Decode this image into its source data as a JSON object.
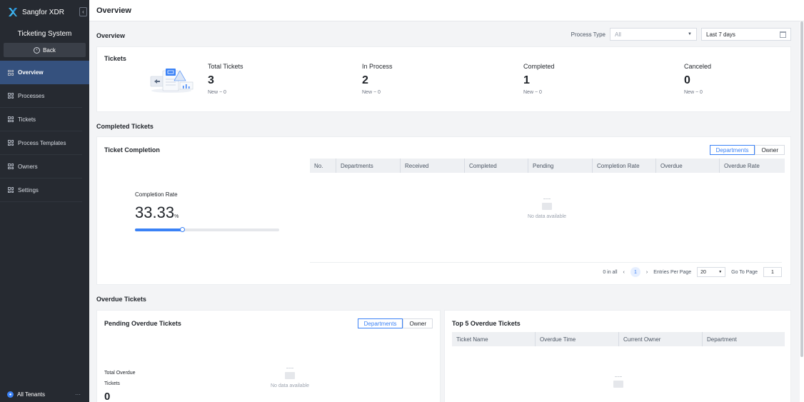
{
  "app": {
    "brand": "Sangfor XDR",
    "system_title": "Ticketing System",
    "back_label": "Back"
  },
  "sidebar": {
    "items": [
      {
        "label": "Overview",
        "active": true
      },
      {
        "label": "Processes",
        "active": false
      },
      {
        "label": "Tickets",
        "active": false
      },
      {
        "label": "Process Templates",
        "active": false
      },
      {
        "label": "Owners",
        "active": false
      },
      {
        "label": "Settings",
        "active": false
      }
    ],
    "tenant": "All Tenants",
    "tenant_more": "···"
  },
  "header": {
    "title": "Overview"
  },
  "overview": {
    "section_title": "Overview",
    "process_type_label": "Process Type",
    "process_type_value": "All",
    "date_range": "Last 7 days"
  },
  "tickets": {
    "title": "Tickets",
    "stats": [
      {
        "label": "Total Tickets",
        "value": "3",
        "new": "New − 0"
      },
      {
        "label": "In Process",
        "value": "2",
        "new": "New − 0"
      },
      {
        "label": "Completed",
        "value": "1",
        "new": "New − 0"
      },
      {
        "label": "Canceled",
        "value": "0",
        "new": "New − 0"
      }
    ]
  },
  "completed": {
    "section_title": "Completed Tickets",
    "card_title": "Ticket Completion",
    "toggle": {
      "departments": "Departments",
      "owner": "Owner"
    },
    "rate_label": "Completion Rate",
    "rate_value": "33.33",
    "rate_unit": "%",
    "rate_fraction": 0.3333,
    "columns": [
      "No.",
      "Departments",
      "Received",
      "Completed",
      "Pending",
      "Completion Rate",
      "Overdue",
      "Overdue Rate"
    ],
    "empty_text": "No data available",
    "pager": {
      "total": "0 in all",
      "prev": "‹",
      "current": "1",
      "next": "›",
      "per_page_label": "Entries Per Page",
      "per_page_value": "20",
      "goto_label": "Go To Page",
      "goto_value": "1"
    }
  },
  "overdue": {
    "section_title": "Overdue Tickets",
    "pending_title": "Pending Overdue Tickets",
    "toggle": {
      "departments": "Departments",
      "owner": "Owner"
    },
    "total_label_1": "Total Overdue",
    "total_label_2": "Tickets",
    "total_value": "0",
    "empty_text": "No data available",
    "top5_title": "Top 5 Overdue Tickets",
    "top5_columns": [
      "Ticket Name",
      "Overdue Time",
      "Current Owner",
      "Department"
    ]
  },
  "colors": {
    "accent": "#3b82f6",
    "sidebar_bg": "#262a31",
    "active_nav": "#35517e"
  }
}
